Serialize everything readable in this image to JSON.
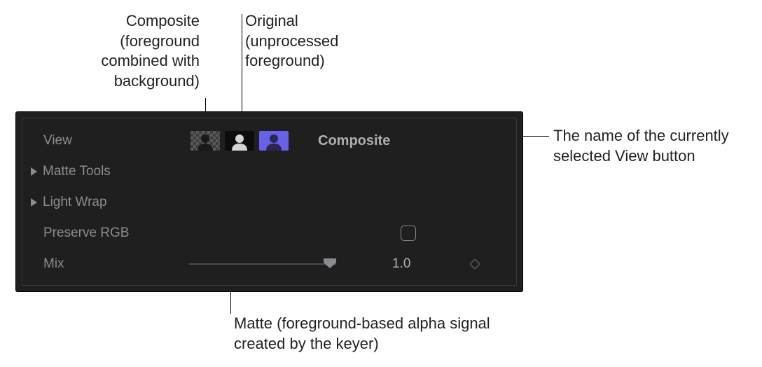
{
  "callouts": {
    "composite": "Composite (foreground combined with background)",
    "original": "Original (unprocessed foreground)",
    "selected_label": "The name of the currently selected View button",
    "matte": "Matte (foreground-based alpha signal created by the keyer)"
  },
  "panel": {
    "view_label": "View",
    "view_buttons": {
      "composite": "Composite",
      "matte": "Matte",
      "original": "Original"
    },
    "selected_view": "Composite",
    "matte_tools_label": "Matte Tools",
    "light_wrap_label": "Light Wrap",
    "preserve_rgb_label": "Preserve RGB",
    "preserve_rgb_checked": false,
    "mix_label": "Mix",
    "mix_value": "1.0"
  }
}
